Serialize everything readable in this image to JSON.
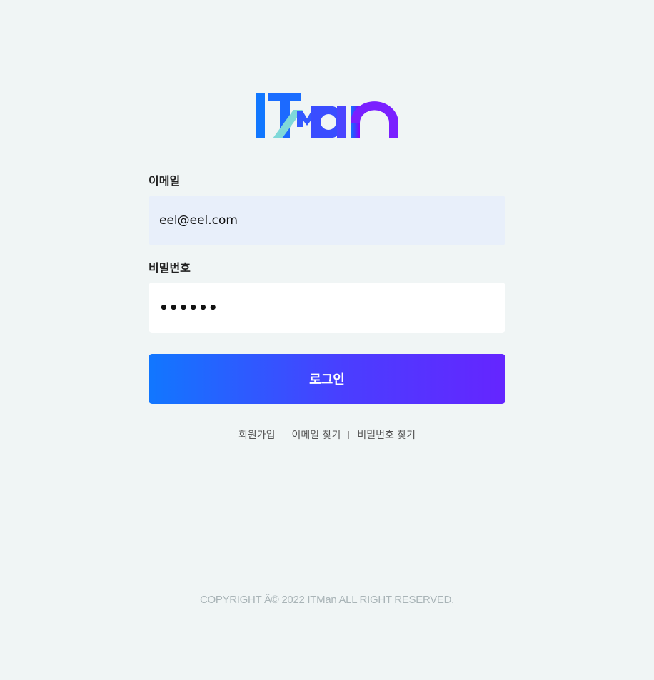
{
  "brand": {
    "logo_text": "ITMan",
    "gradient_start": "#1177ff",
    "gradient_end": "#8800ff",
    "accent_teal": "#7fd9d9"
  },
  "login_form": {
    "email_label": "이메일",
    "email_value": "eel@eel.com",
    "password_label": "비밀번호",
    "password_value": "••••••",
    "submit_label": "로그인"
  },
  "links": {
    "signup": "회원가입",
    "find_email": "이메일 찾기",
    "find_password": "비밀번호 찾기"
  },
  "footer": {
    "copyright": "COPYRIGHT Â© 2022 ITMan ALL RIGHT RESERVED."
  }
}
